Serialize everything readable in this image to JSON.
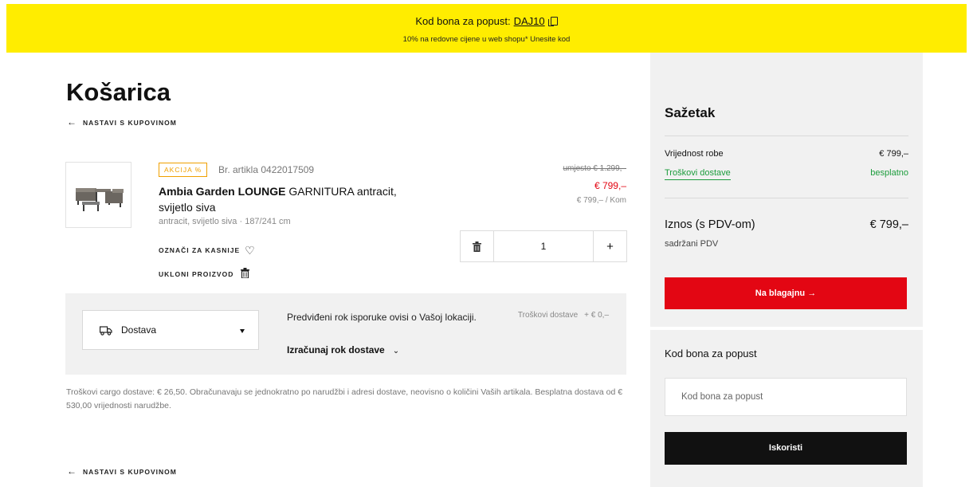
{
  "promo": {
    "label": "Kod bona za popust:",
    "code": "DAJ10",
    "subtext": "10% na redovne cijene u web shopu* Unesite kod"
  },
  "page_title": "Košarica",
  "back_link": "NASTAVI S KUPOVINOM",
  "item": {
    "badge": "AKCIJA %",
    "article_number": "Br. artikla 0422017509",
    "name_bold": "Ambia Garden LOUNGE",
    "name_rest": " GARNITURA antracit, svijetlo siva",
    "variant": "antracit, svijetlo siva  ·  187/241 cm",
    "old_price": "umjesto € 1.299,–",
    "price": "€ 799,–",
    "unit_price": "€ 799,– / Kom",
    "save_later": "OZNAČI ZA KASNIJE",
    "remove": "UKLONI PROIZVOD",
    "quantity": "1",
    "plus": "+"
  },
  "delivery": {
    "option": "Dostava",
    "info": "Predviđeni rok isporuke ovisi o Vašoj lokaciji.",
    "calculate": "Izračunaj rok dostave",
    "cost_label": "Troškovi dostave",
    "cost_value": "+ € 0,–"
  },
  "cargo_note": "Troškovi cargo dostave: € 26,50. Obračunavaju se jednokratno po narudžbi i adresi dostave, neovisno o količini Vaših artikala. Besplatna dostava od € 530,00 vrijednosti narudžbe.",
  "summary": {
    "title": "Sažetak",
    "goods_label": "Vrijednost robe",
    "goods_value": "€ 799,–",
    "shipping_label": "Troškovi dostave",
    "shipping_value": "besplatno",
    "total_label": "Iznos (s PDV-om)",
    "total_value": "€ 799,–",
    "vat_note": "sadržani PDV",
    "checkout": "Na blagajnu →"
  },
  "voucher": {
    "title": "Kod bona za popust",
    "placeholder": "Kod bona za popust",
    "apply": "Iskoristi"
  },
  "colors": {
    "promo_bg": "#ffed00",
    "accent_red": "#e30613",
    "green": "#1c9c3c",
    "badge_orange": "#f0a000"
  }
}
